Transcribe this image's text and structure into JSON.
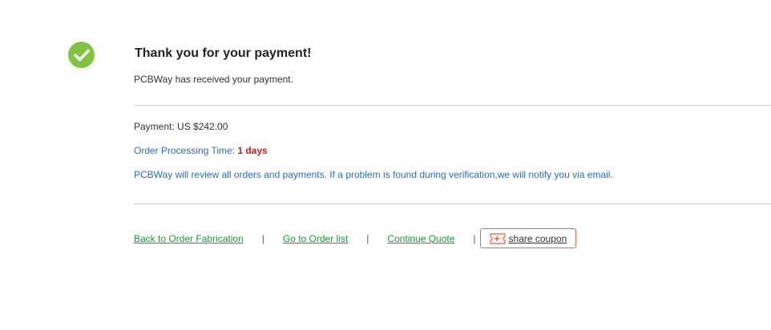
{
  "header": {
    "title": "Thank you for your payment!",
    "subtitle": "PCBWay has received your payment."
  },
  "details": {
    "payment": "Payment: US $242.00",
    "processing_label": "Order Processing Time: ",
    "processing_value": "1 days",
    "notice": "PCBWay will review all orders and payments. If a problem is found during verification,we will notify you via email."
  },
  "actions": {
    "back_label": "Back to Order Fabrication",
    "order_list_label": "Go to Order list",
    "continue_label": "Continue Quote",
    "separator": "|",
    "share_label": "share coupon"
  },
  "icons": {
    "success": "check-circle-icon",
    "coupon": "coupon-ticket-icon"
  },
  "colors": {
    "success": "#80c342",
    "link": "#1a9a3c",
    "info": "#2b6cc4",
    "highlight": "#c81e1e",
    "coupon_border": "#e8624a"
  }
}
